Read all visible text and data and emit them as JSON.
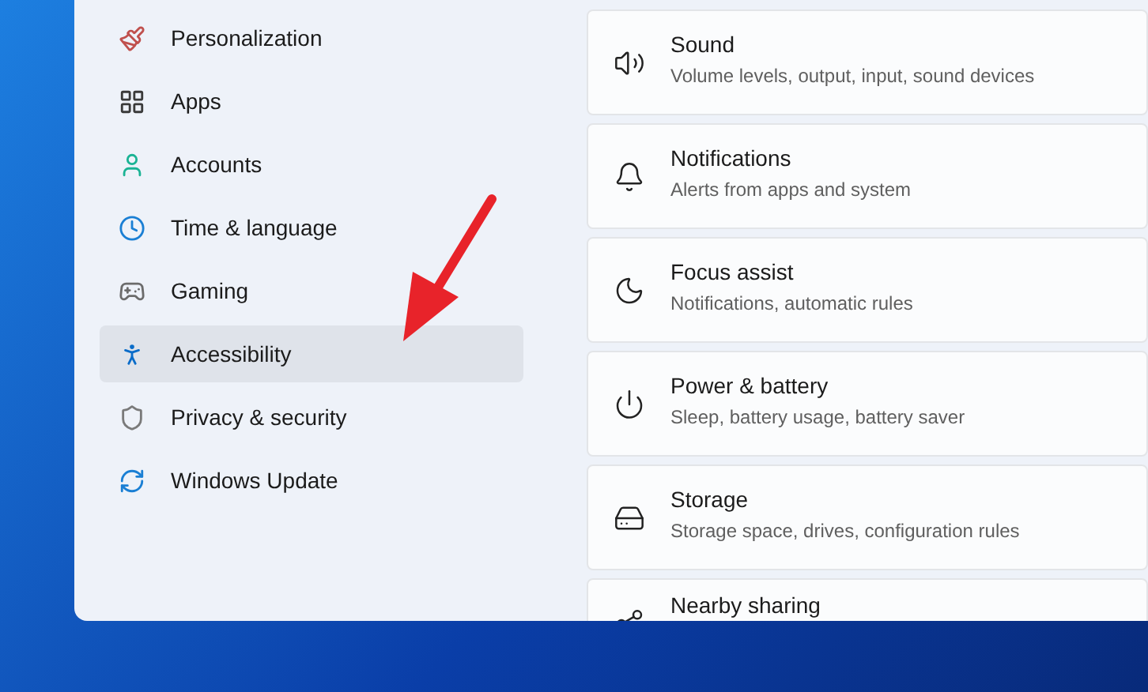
{
  "sidebar": {
    "items": [
      {
        "label": "Personalization",
        "selected": false
      },
      {
        "label": "Apps",
        "selected": false
      },
      {
        "label": "Accounts",
        "selected": false
      },
      {
        "label": "Time & language",
        "selected": false
      },
      {
        "label": "Gaming",
        "selected": false
      },
      {
        "label": "Accessibility",
        "selected": true
      },
      {
        "label": "Privacy & security",
        "selected": false
      },
      {
        "label": "Windows Update",
        "selected": false
      }
    ]
  },
  "settings": [
    {
      "title": "Sound",
      "description": "Volume levels, output, input, sound devices"
    },
    {
      "title": "Notifications",
      "description": "Alerts from apps and system"
    },
    {
      "title": "Focus assist",
      "description": "Notifications, automatic rules"
    },
    {
      "title": "Power & battery",
      "description": "Sleep, battery usage, battery saver"
    },
    {
      "title": "Storage",
      "description": "Storage space, drives, configuration rules"
    },
    {
      "title": "Nearby sharing"
    }
  ]
}
